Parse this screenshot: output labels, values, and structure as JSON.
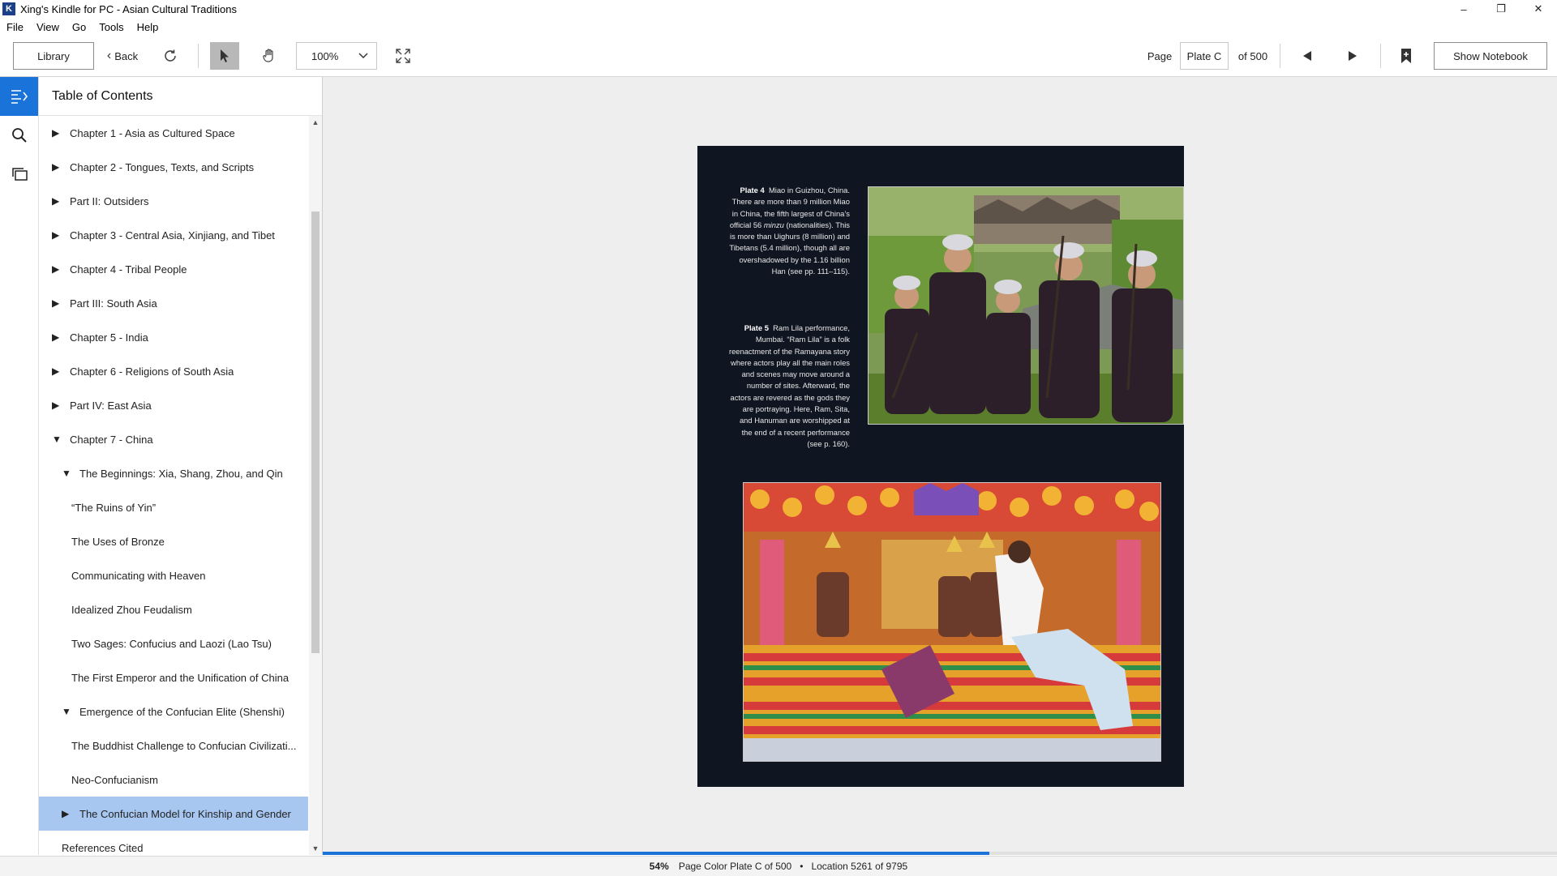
{
  "window": {
    "title": "Xing's Kindle for PC - Asian Cultural Traditions",
    "app_icon": "kindle-app-icon",
    "minimize": "–",
    "maximize": "❐",
    "close": "✕"
  },
  "menu": {
    "file": "File",
    "view": "View",
    "go": "Go",
    "tools": "Tools",
    "help": "Help"
  },
  "toolbar": {
    "library": "Library",
    "back": "Back",
    "zoom": "100%",
    "page_label": "Page",
    "page_value": "Plate C",
    "page_of": "of 500",
    "show_notebook": "Show Notebook"
  },
  "toc": {
    "title": "Table of Contents",
    "items": [
      {
        "label": "Chapter 1 - Asia as Cultured Space",
        "arrow": "▶"
      },
      {
        "label": "Chapter 2 - Tongues, Texts, and Scripts",
        "arrow": "▶"
      },
      {
        "label": "Part II: Outsiders",
        "arrow": "▶"
      },
      {
        "label": "Chapter 3 - Central Asia, Xinjiang, and Tibet",
        "arrow": "▶"
      },
      {
        "label": "Chapter 4 - Tribal People",
        "arrow": "▶"
      },
      {
        "label": "Part III: South Asia",
        "arrow": "▶"
      },
      {
        "label": "Chapter 5 - India",
        "arrow": "▶"
      },
      {
        "label": "Chapter 6 - Religions of South Asia",
        "arrow": "▶"
      },
      {
        "label": "Part IV: East Asia",
        "arrow": "▶"
      },
      {
        "label": "Chapter 7 - China",
        "arrow": "▼"
      },
      {
        "label": "The Beginnings: Xia, Shang, Zhou, and Qin",
        "arrow": "▼"
      },
      {
        "label": "“The Ruins of Yin”",
        "arrow": ""
      },
      {
        "label": "The Uses of Bronze",
        "arrow": ""
      },
      {
        "label": "Communicating with Heaven",
        "arrow": ""
      },
      {
        "label": "Idealized Zhou Feudalism",
        "arrow": ""
      },
      {
        "label": "Two Sages: Confucius and Laozi (Lao Tsu)",
        "arrow": ""
      },
      {
        "label": "The First Emperor and the Unification of China",
        "arrow": ""
      },
      {
        "label": "Emergence of the Confucian Elite (Shenshi)",
        "arrow": "▼"
      },
      {
        "label": "The Buddhist Challenge to Confucian Civilizati...",
        "arrow": ""
      },
      {
        "label": "Neo-Confucianism",
        "arrow": ""
      },
      {
        "label": "The Confucian Model for Kinship and Gender",
        "arrow": "▶"
      },
      {
        "label": "References Cited",
        "arrow": ""
      }
    ]
  },
  "page": {
    "plate4_label": "Plate 4",
    "plate4_text_a": "Miao in Guizhou, China. There are more than 9 million Miao in China, the fifth largest of China’s official 56",
    "plate4_text_italic": "minzu",
    "plate4_text_b": "(nationalities). This is more than Uighurs (8 million) and Tibetans (5.4 million), though all are overshadowed by the 1.16 billion Han (see pp. 111–115).",
    "plate5_label": "Plate 5",
    "plate5_text": "Ram Lila performance, Mumbai. “Ram Lila” is a folk reenactment of the Ramayana story where actors play all the main roles and scenes may move around a number of sites. Afterward, the actors are revered as the gods they are portraying. Here, Ram, Sita, and Hanuman are worshipped at the end of a recent performance (see p. 160)."
  },
  "status": {
    "percent": "54%",
    "page_text": "Page Color Plate C of 500",
    "separator": "•",
    "location_text": "Location 5261 of 9795",
    "progress_fraction": 0.54
  }
}
